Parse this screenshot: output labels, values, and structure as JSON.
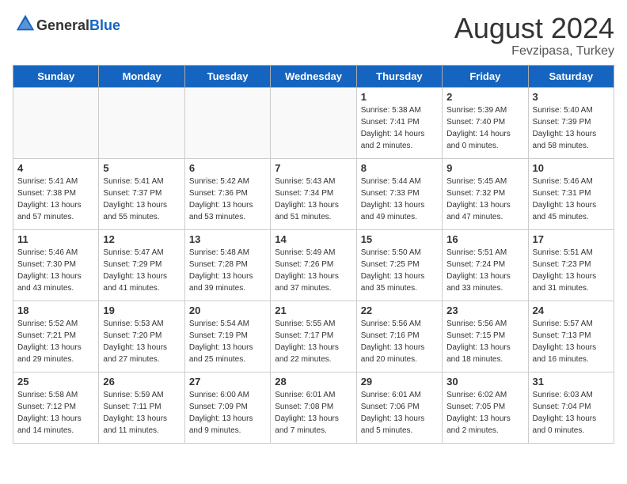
{
  "header": {
    "logo_general": "General",
    "logo_blue": "Blue",
    "title": "August 2024",
    "subtitle": "Fevzipasa, Turkey"
  },
  "days_of_week": [
    "Sunday",
    "Monday",
    "Tuesday",
    "Wednesday",
    "Thursday",
    "Friday",
    "Saturday"
  ],
  "weeks": [
    [
      {
        "day": "",
        "info": ""
      },
      {
        "day": "",
        "info": ""
      },
      {
        "day": "",
        "info": ""
      },
      {
        "day": "",
        "info": ""
      },
      {
        "day": "1",
        "info": "Sunrise: 5:38 AM\nSunset: 7:41 PM\nDaylight: 14 hours\nand 2 minutes."
      },
      {
        "day": "2",
        "info": "Sunrise: 5:39 AM\nSunset: 7:40 PM\nDaylight: 14 hours\nand 0 minutes."
      },
      {
        "day": "3",
        "info": "Sunrise: 5:40 AM\nSunset: 7:39 PM\nDaylight: 13 hours\nand 58 minutes."
      }
    ],
    [
      {
        "day": "4",
        "info": "Sunrise: 5:41 AM\nSunset: 7:38 PM\nDaylight: 13 hours\nand 57 minutes."
      },
      {
        "day": "5",
        "info": "Sunrise: 5:41 AM\nSunset: 7:37 PM\nDaylight: 13 hours\nand 55 minutes."
      },
      {
        "day": "6",
        "info": "Sunrise: 5:42 AM\nSunset: 7:36 PM\nDaylight: 13 hours\nand 53 minutes."
      },
      {
        "day": "7",
        "info": "Sunrise: 5:43 AM\nSunset: 7:34 PM\nDaylight: 13 hours\nand 51 minutes."
      },
      {
        "day": "8",
        "info": "Sunrise: 5:44 AM\nSunset: 7:33 PM\nDaylight: 13 hours\nand 49 minutes."
      },
      {
        "day": "9",
        "info": "Sunrise: 5:45 AM\nSunset: 7:32 PM\nDaylight: 13 hours\nand 47 minutes."
      },
      {
        "day": "10",
        "info": "Sunrise: 5:46 AM\nSunset: 7:31 PM\nDaylight: 13 hours\nand 45 minutes."
      }
    ],
    [
      {
        "day": "11",
        "info": "Sunrise: 5:46 AM\nSunset: 7:30 PM\nDaylight: 13 hours\nand 43 minutes."
      },
      {
        "day": "12",
        "info": "Sunrise: 5:47 AM\nSunset: 7:29 PM\nDaylight: 13 hours\nand 41 minutes."
      },
      {
        "day": "13",
        "info": "Sunrise: 5:48 AM\nSunset: 7:28 PM\nDaylight: 13 hours\nand 39 minutes."
      },
      {
        "day": "14",
        "info": "Sunrise: 5:49 AM\nSunset: 7:26 PM\nDaylight: 13 hours\nand 37 minutes."
      },
      {
        "day": "15",
        "info": "Sunrise: 5:50 AM\nSunset: 7:25 PM\nDaylight: 13 hours\nand 35 minutes."
      },
      {
        "day": "16",
        "info": "Sunrise: 5:51 AM\nSunset: 7:24 PM\nDaylight: 13 hours\nand 33 minutes."
      },
      {
        "day": "17",
        "info": "Sunrise: 5:51 AM\nSunset: 7:23 PM\nDaylight: 13 hours\nand 31 minutes."
      }
    ],
    [
      {
        "day": "18",
        "info": "Sunrise: 5:52 AM\nSunset: 7:21 PM\nDaylight: 13 hours\nand 29 minutes."
      },
      {
        "day": "19",
        "info": "Sunrise: 5:53 AM\nSunset: 7:20 PM\nDaylight: 13 hours\nand 27 minutes."
      },
      {
        "day": "20",
        "info": "Sunrise: 5:54 AM\nSunset: 7:19 PM\nDaylight: 13 hours\nand 25 minutes."
      },
      {
        "day": "21",
        "info": "Sunrise: 5:55 AM\nSunset: 7:17 PM\nDaylight: 13 hours\nand 22 minutes."
      },
      {
        "day": "22",
        "info": "Sunrise: 5:56 AM\nSunset: 7:16 PM\nDaylight: 13 hours\nand 20 minutes."
      },
      {
        "day": "23",
        "info": "Sunrise: 5:56 AM\nSunset: 7:15 PM\nDaylight: 13 hours\nand 18 minutes."
      },
      {
        "day": "24",
        "info": "Sunrise: 5:57 AM\nSunset: 7:13 PM\nDaylight: 13 hours\nand 16 minutes."
      }
    ],
    [
      {
        "day": "25",
        "info": "Sunrise: 5:58 AM\nSunset: 7:12 PM\nDaylight: 13 hours\nand 14 minutes."
      },
      {
        "day": "26",
        "info": "Sunrise: 5:59 AM\nSunset: 7:11 PM\nDaylight: 13 hours\nand 11 minutes."
      },
      {
        "day": "27",
        "info": "Sunrise: 6:00 AM\nSunset: 7:09 PM\nDaylight: 13 hours\nand 9 minutes."
      },
      {
        "day": "28",
        "info": "Sunrise: 6:01 AM\nSunset: 7:08 PM\nDaylight: 13 hours\nand 7 minutes."
      },
      {
        "day": "29",
        "info": "Sunrise: 6:01 AM\nSunset: 7:06 PM\nDaylight: 13 hours\nand 5 minutes."
      },
      {
        "day": "30",
        "info": "Sunrise: 6:02 AM\nSunset: 7:05 PM\nDaylight: 13 hours\nand 2 minutes."
      },
      {
        "day": "31",
        "info": "Sunrise: 6:03 AM\nSunset: 7:04 PM\nDaylight: 13 hours\nand 0 minutes."
      }
    ]
  ]
}
